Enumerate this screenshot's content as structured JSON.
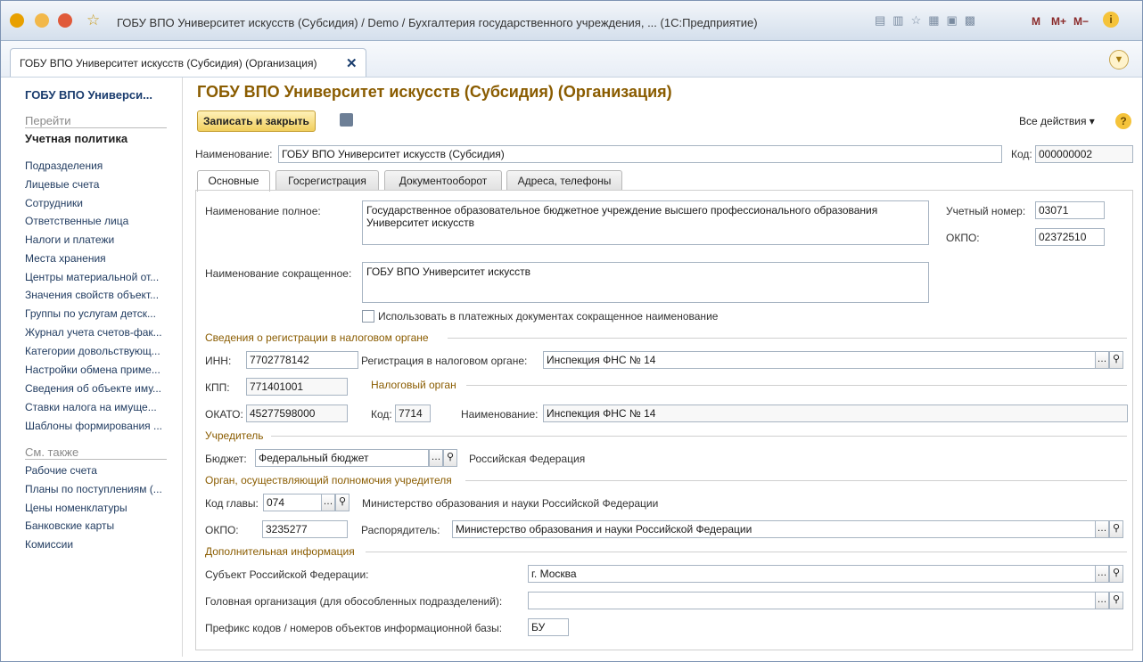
{
  "window": {
    "title": "ГОБУ ВПО Университет искусств (Субсидия) / Demo / Бухгалтерия государственного учреждения, ...  (1С:Предприятие)",
    "toolbar_right": [
      "M",
      "M+",
      "M−"
    ]
  },
  "tab": {
    "label": "ГОБУ ВПО Университет искусств (Субсидия) (Организация)",
    "close": "✕"
  },
  "sidebar": {
    "title": "ГОБУ ВПО Универси...",
    "goto_header": "Перейти",
    "current": "Учетная политика",
    "items": [
      "Подразделения",
      "Лицевые счета",
      "Сотрудники",
      "Ответственные лица",
      "Налоги и платежи",
      "Места хранения",
      "Центры материальной от...",
      "Значения свойств объект...",
      "Группы по услугам детск...",
      "Журнал учета счетов-фак...",
      "Категории довольствующ...",
      "Настройки обмена приме...",
      "Сведения об объекте иму...",
      "Ставки налога на имуще...",
      "Шаблоны формирования ..."
    ],
    "see_also_header": "См. также",
    "see_also": [
      "Рабочие счета",
      "Планы по поступлениям (...",
      "Цены номенклатуры",
      "Банковские карты",
      "Комиссии"
    ]
  },
  "form": {
    "title": "ГОБУ ВПО Университет искусств (Субсидия) (Организация)",
    "save_close": "Записать и закрыть",
    "all_actions": "Все действия ▾",
    "help": "?",
    "name_label": "Наименование:",
    "name_value": "ГОБУ ВПО Университет искусств (Субсидия)",
    "code_label": "Код:",
    "code_value": "000000002",
    "tabs": [
      "Основные",
      "Госрегистрация",
      "Документооборот",
      "Адреса, телефоны"
    ],
    "full_name_label": "Наименование полное:",
    "full_name_value": "Государственное образовательное бюджетное учреждение высшего профессионального образования Университет искусств",
    "acc_num_label": "Учетный номер:",
    "acc_num_value": "03071",
    "okpo_label": "ОКПО:",
    "okpo_value": "02372510",
    "short_name_label": "Наименование сокращенное:",
    "short_name_value": "ГОБУ ВПО Университет искусств",
    "use_short_label": "Использовать в платежных документах сокращенное наименование",
    "tax_group": "Сведения о регистрации в налоговом органе",
    "inn_label": "ИНН:",
    "inn_value": "7702778142",
    "reg_label": "Регистрация в налоговом органе:",
    "reg_value": "Инспекция ФНС № 14",
    "kpp_label": "КПП:",
    "kpp_value": "771401001",
    "tax_org_group": "Налоговый орган",
    "okato_label": "ОКАТО:",
    "okato_value": "45277598000",
    "tax_code_label": "Код:",
    "tax_code_value": "7714",
    "tax_name_label": "Наименование:",
    "tax_name_value": "Инспекция ФНС № 14",
    "founder_group": "Учредитель",
    "budget_label": "Бюджет:",
    "budget_value": "Федеральный бюджет",
    "budget_note": "Российская Федерация",
    "authority_group": "Орган, осуществляющий полномочия учредителя",
    "head_code_label": "Код главы:",
    "head_code_value": "074",
    "ministry_note": "Министерство образования и науки Российской Федерации",
    "okpo2_label": "ОКПО:",
    "okpo2_value": "3235277",
    "manager_label": "Распорядитель:",
    "manager_value": "Министерство образования и науки Российской Федерации",
    "extra_group": "Дополнительная информация",
    "subject_label": "Субъект Российской Федерации:",
    "subject_value": "г. Москва",
    "parent_label": "Головная организация (для обособленных подразделений):",
    "parent_value": "",
    "prefix_label": "Префикс кодов / номеров объектов информационной базы:",
    "prefix_value": "БУ"
  }
}
